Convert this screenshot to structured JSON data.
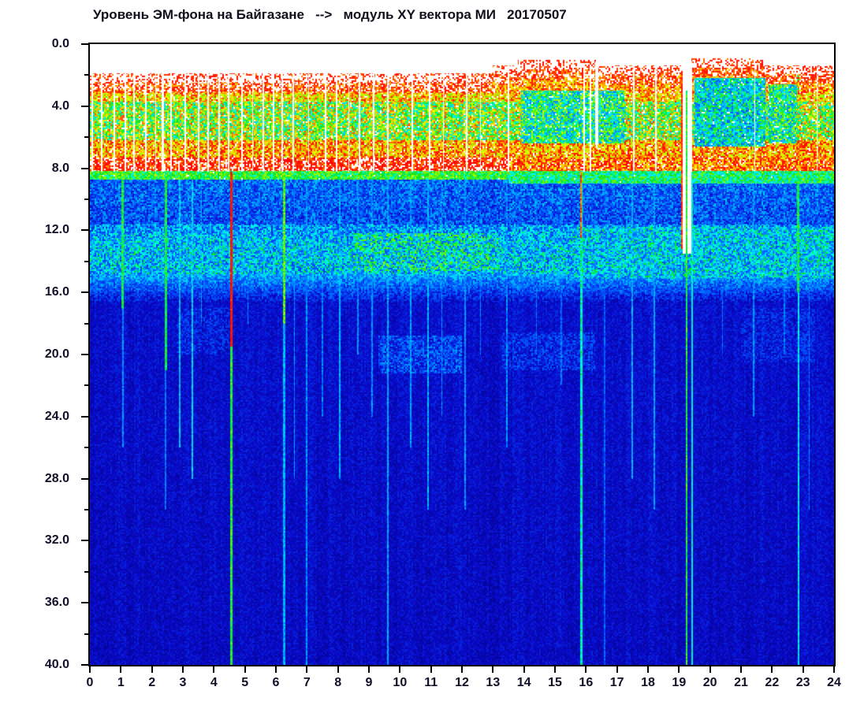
{
  "page": {
    "background": "#ffffff"
  },
  "chart_data": {
    "type": "heatmap",
    "subtype": "spectrogram",
    "title": "Уровень ЭМ-фона на Байгазане   -->   модуль XY вектора МИ   20170507",
    "x_axis": {
      "label": "",
      "min": 0,
      "max": 24,
      "unit": "hours",
      "tick_labels": [
        "0",
        "1",
        "2",
        "3",
        "4",
        "5",
        "6",
        "7",
        "8",
        "9",
        "10",
        "11",
        "12",
        "13",
        "14",
        "15",
        "16",
        "17",
        "18",
        "19",
        "20",
        "21",
        "22",
        "23",
        "24"
      ]
    },
    "y_axis": {
      "label": "",
      "min": 0,
      "max": 40,
      "unit": "Hz",
      "direction": "down",
      "tick_labels": [
        "0.0",
        "4.0",
        "8.0",
        "12.0",
        "16.0",
        "20.0",
        "24.0",
        "28.0",
        "32.0",
        "36.0",
        "40.0"
      ],
      "major_tick_step": 4,
      "minor_tick_step": 2
    },
    "colors": {
      "axis_text": "#101028",
      "axis_line": "#000000",
      "plot_background": "#ffffff",
      "deep_blue": "#0f0fc4",
      "cyan": "#00c8ff",
      "green": "#00dc28",
      "yellow": "#ebff00",
      "red": "#ff1e00",
      "white_saturated": "#ffffff"
    },
    "palette": {
      "white_above": 1.04,
      "stops": [
        [
          0.0,
          0,
          0,
          110
        ],
        [
          0.15,
          10,
          10,
          205
        ],
        [
          0.3,
          0,
          90,
          255
        ],
        [
          0.42,
          0,
          195,
          255
        ],
        [
          0.5,
          0,
          255,
          230
        ],
        [
          0.58,
          0,
          225,
          45
        ],
        [
          0.66,
          120,
          250,
          0
        ],
        [
          0.74,
          235,
          255,
          0
        ],
        [
          0.82,
          255,
          170,
          0
        ],
        [
          0.9,
          255,
          30,
          0
        ],
        [
          1.0,
          255,
          0,
          0
        ]
      ]
    },
    "top_zone": {
      "white_start_left": 1.9,
      "white_start_right": 1.35,
      "right_from_hour": 13,
      "dips": [
        {
          "t0": 13.8,
          "t1": 16.4,
          "f": 1.0
        },
        {
          "t0": 19.4,
          "t1": 21.7,
          "f": 0.9
        }
      ]
    },
    "fringe": [
      {
        "rel_end": 0.6,
        "v": 0.9,
        "n": 0.05,
        "wp": 0.62
      },
      {
        "rel_end": 1.2,
        "v": 0.88,
        "n": 0.08,
        "wp": 0.34
      },
      {
        "abs_end": 3.2,
        "v": 0.83,
        "n": 0.11,
        "wp": 0.12
      }
    ],
    "bands": [
      {
        "f0": 3.2,
        "f1": 3.7,
        "v": 0.78,
        "n": 0.14,
        "wp": 0.07
      },
      {
        "f0": 3.7,
        "f1": 6.2,
        "v": 0.66,
        "n": 0.22,
        "wp": 0.05
      },
      {
        "f0": 6.2,
        "f1": 7.3,
        "v": 0.82,
        "n": 0.14,
        "wp": 0.06
      },
      {
        "f0": 7.3,
        "f1": 8.15,
        "v": 0.92,
        "n": 0.1,
        "wp": 0.3
      },
      {
        "f0": 8.15,
        "f1": 8.75,
        "v": 0.6,
        "n": 0.1,
        "wp": 0.01
      },
      {
        "f0": 8.75,
        "f1": 11.6,
        "v": 0.31,
        "v2": 0.27,
        "n": 0.13,
        "wp": 0
      },
      {
        "f0": 11.6,
        "f1": 13.0,
        "v": 0.36,
        "v2": 0.42,
        "n": 0.16,
        "wp": 0
      },
      {
        "f0": 13.0,
        "f1": 14.8,
        "v": 0.42,
        "n": 0.17,
        "wp": 0
      },
      {
        "f0": 14.8,
        "f1": 16.6,
        "v": 0.4,
        "v2": 0.17,
        "n": 0.1,
        "wp": 0
      },
      {
        "f0": 16.6,
        "f1": 40.01,
        "v": 0.155,
        "v2": 0.132,
        "n": 0.055,
        "wp": 0
      }
    ],
    "regions": [
      {
        "t0": 13.5,
        "t1": 24.01,
        "f0": 7.3,
        "f1": 8.15,
        "v": 0.86,
        "n": 0.14,
        "wp": 0.1
      },
      {
        "t0": 13.9,
        "t1": 17.25,
        "f0": 3.0,
        "f1": 6.4,
        "v": 0.53,
        "n": 0.2,
        "wp": 0.04
      },
      {
        "t0": 19.5,
        "t1": 21.8,
        "f0": 2.2,
        "f1": 6.6,
        "v": 0.47,
        "n": 0.18,
        "wp": 0.04
      },
      {
        "t0": 21.9,
        "t1": 22.8,
        "f0": 2.6,
        "f1": 6.4,
        "v": 0.53,
        "n": 0.2,
        "wp": 0.04
      },
      {
        "t0": 13.5,
        "t1": 24.01,
        "f0": 8.15,
        "f1": 9.0,
        "v": 0.55,
        "n": 0.12,
        "wp": 0.01
      },
      {
        "t0": 8.5,
        "t1": 13.2,
        "f0": 12.2,
        "f1": 14.6,
        "v": 0.47,
        "n": 0.2,
        "wp": 0
      },
      {
        "t0": 15.5,
        "t1": 24.01,
        "f0": 11.8,
        "f1": 15.1,
        "v": 0.43,
        "n": 0.16,
        "wp": 0
      },
      {
        "t0": 9.3,
        "t1": 12.0,
        "f0": 18.8,
        "f1": 21.2,
        "v": 0.25,
        "n": 0.13,
        "wp": 0
      },
      {
        "t0": 13.3,
        "t1": 16.3,
        "f0": 18.6,
        "f1": 21.0,
        "v": 0.21,
        "n": 0.11,
        "wp": 0
      },
      {
        "t0": 2.8,
        "t1": 4.5,
        "f0": 17.0,
        "f1": 20.0,
        "v": 0.19,
        "n": 0.1,
        "wp": 0
      },
      {
        "t0": 21.0,
        "t1": 23.4,
        "f0": 17.0,
        "f1": 20.5,
        "v": 0.19,
        "n": 0.09,
        "wp": 0
      }
    ],
    "vertical_lines": [
      {
        "t": 1.06,
        "w": 0.07,
        "f0": 8.2,
        "f1": 17,
        "v": 0.58
      },
      {
        "t": 1.06,
        "w": 0.05,
        "f0": 17,
        "f1": 26,
        "v": 0.36
      },
      {
        "t": 2.45,
        "w": 0.07,
        "f0": 8.2,
        "f1": 21,
        "v": 0.58
      },
      {
        "t": 2.45,
        "w": 0.05,
        "f0": 21,
        "f1": 30,
        "v": 0.33
      },
      {
        "t": 2.9,
        "w": 0.05,
        "f0": 8.2,
        "f1": 26,
        "v": 0.42
      },
      {
        "t": 3.3,
        "w": 0.06,
        "f0": 8.2,
        "f1": 28,
        "v": 0.44
      },
      {
        "t": 3.6,
        "w": 0.04,
        "f0": 8.2,
        "f1": 18,
        "v": 0.38
      },
      {
        "t": 4.57,
        "w": 0.07,
        "f0": 8.2,
        "f1": 19.5,
        "v": 0.93
      },
      {
        "t": 4.57,
        "w": 0.07,
        "f0": 19.5,
        "f1": 40,
        "v": 0.6
      },
      {
        "t": 5.1,
        "w": 0.04,
        "f0": 8.7,
        "f1": 18,
        "v": 0.34
      },
      {
        "t": 6.27,
        "w": 0.08,
        "f0": 8.2,
        "f1": 18,
        "v": 0.64
      },
      {
        "t": 6.27,
        "w": 0.06,
        "f0": 18,
        "f1": 40,
        "v": 0.4
      },
      {
        "t": 6.6,
        "w": 0.04,
        "f0": 8.7,
        "f1": 28,
        "v": 0.36
      },
      {
        "t": 7.0,
        "w": 0.05,
        "f0": 8.7,
        "f1": 40,
        "v": 0.36
      },
      {
        "t": 7.5,
        "w": 0.04,
        "f0": 8.7,
        "f1": 24,
        "v": 0.34
      },
      {
        "t": 8.05,
        "w": 0.05,
        "f0": 8.7,
        "f1": 28,
        "v": 0.4
      },
      {
        "t": 8.65,
        "w": 0.04,
        "f0": 8.7,
        "f1": 20,
        "v": 0.36
      },
      {
        "t": 9.1,
        "w": 0.04,
        "f0": 8.7,
        "f1": 24,
        "v": 0.36
      },
      {
        "t": 9.62,
        "w": 0.05,
        "f0": 8.7,
        "f1": 40,
        "v": 0.38
      },
      {
        "t": 10.35,
        "w": 0.05,
        "f0": 8.7,
        "f1": 26,
        "v": 0.38
      },
      {
        "t": 10.9,
        "w": 0.05,
        "f0": 8.7,
        "f1": 30,
        "v": 0.4
      },
      {
        "t": 11.35,
        "w": 0.04,
        "f0": 8.7,
        "f1": 24,
        "v": 0.36
      },
      {
        "t": 12.1,
        "w": 0.05,
        "f0": 8.7,
        "f1": 30,
        "v": 0.36
      },
      {
        "t": 12.6,
        "w": 0.04,
        "f0": 8.7,
        "f1": 20,
        "v": 0.33
      },
      {
        "t": 13.45,
        "w": 0.05,
        "f0": 8.7,
        "f1": 26,
        "v": 0.36
      },
      {
        "t": 14.4,
        "w": 0.04,
        "f0": 8.7,
        "f1": 20,
        "v": 0.33
      },
      {
        "t": 15.2,
        "w": 0.04,
        "f0": 8.7,
        "f1": 22,
        "v": 0.32
      },
      {
        "t": 15.85,
        "w": 0.08,
        "f0": 8.2,
        "f1": 40,
        "v": 0.52
      },
      {
        "t": 15.85,
        "w": 0.05,
        "f0": 8.2,
        "f1": 12.5,
        "v": 0.88
      },
      {
        "t": 16.6,
        "w": 0.05,
        "f0": 8.7,
        "f1": 40,
        "v": 0.3
      },
      {
        "t": 17.5,
        "w": 0.05,
        "f0": 8.2,
        "f1": 28,
        "v": 0.4
      },
      {
        "t": 18.2,
        "w": 0.05,
        "f0": 8.2,
        "f1": 30,
        "v": 0.38
      },
      {
        "t": 19.1,
        "w": 0.05,
        "f0": 1.8,
        "f1": 13.2,
        "v": 0.9
      },
      {
        "t": 19.25,
        "w": 0.06,
        "f0": 3.0,
        "f1": 40,
        "v": 0.6
      },
      {
        "t": 19.42,
        "w": 0.05,
        "f0": 8.2,
        "f1": 40,
        "v": 0.5
      },
      {
        "t": 20.4,
        "w": 0.04,
        "f0": 8.7,
        "f1": 20,
        "v": 0.32
      },
      {
        "t": 21.4,
        "w": 0.04,
        "f0": 8.7,
        "f1": 24,
        "v": 0.36
      },
      {
        "t": 22.4,
        "w": 0.04,
        "f0": 8.7,
        "f1": 20,
        "v": 0.33
      },
      {
        "t": 22.85,
        "w": 0.07,
        "f0": 2.0,
        "f1": 16,
        "v": 0.58
      },
      {
        "t": 22.85,
        "w": 0.06,
        "f0": 16,
        "f1": 40,
        "v": 0.46
      },
      {
        "t": 23.2,
        "w": 0.04,
        "f0": 8.7,
        "f1": 30,
        "v": 0.33
      }
    ],
    "white_gaps": [
      {
        "t": 0.07,
        "w": 0.06
      },
      {
        "t": 0.38,
        "w": 0.06
      },
      {
        "t": 0.78,
        "w": 0.05
      },
      {
        "t": 1.15,
        "w": 0.04
      },
      {
        "t": 1.42,
        "w": 0.05
      },
      {
        "t": 1.8,
        "w": 0.05
      },
      {
        "t": 2.12,
        "w": 0.04
      },
      {
        "t": 2.35,
        "w": 0.06
      },
      {
        "t": 2.62,
        "w": 0.04
      },
      {
        "t": 3.08,
        "w": 0.05
      },
      {
        "t": 3.5,
        "w": 0.05
      },
      {
        "t": 3.82,
        "w": 0.04
      },
      {
        "t": 4.18,
        "w": 0.05
      },
      {
        "t": 4.48,
        "w": 0.04
      },
      {
        "t": 4.9,
        "w": 0.05
      },
      {
        "t": 5.25,
        "w": 0.05
      },
      {
        "t": 5.6,
        "w": 0.04
      },
      {
        "t": 5.92,
        "w": 0.05
      },
      {
        "t": 6.2,
        "w": 0.04
      },
      {
        "t": 6.55,
        "w": 0.05
      },
      {
        "t": 7.05,
        "w": 0.03
      },
      {
        "t": 7.6,
        "w": 0.04
      },
      {
        "t": 7.95,
        "w": 0.05
      },
      {
        "t": 8.35,
        "w": 0.04
      },
      {
        "t": 8.7,
        "w": 0.05
      },
      {
        "t": 9.15,
        "w": 0.04
      },
      {
        "t": 9.6,
        "w": 0.05
      },
      {
        "t": 10.4,
        "w": 0.05
      },
      {
        "t": 10.95,
        "w": 0.05
      },
      {
        "t": 11.4,
        "w": 0.04
      },
      {
        "t": 12.15,
        "w": 0.05
      },
      {
        "t": 12.6,
        "w": 0.03
      },
      {
        "t": 13.5,
        "w": 0.05
      },
      {
        "t": 15.95,
        "w": 0.05
      },
      {
        "t": 16.15,
        "w": 0.04
      },
      {
        "t": 16.35,
        "w": 0.09,
        "f0": 1.1,
        "f1": 6.5
      },
      {
        "t": 17.55,
        "w": 0.05
      },
      {
        "t": 18.25,
        "w": 0.05
      },
      {
        "t": 19.28,
        "w": 0.3,
        "f0": 1.1,
        "f1": 13.5
      },
      {
        "t": 21.45,
        "w": 0.04
      },
      {
        "t": 23.45,
        "w": 0.04
      }
    ],
    "white_gap_default_f0": 1.3,
    "white_gap_default_f1": 8.2
  }
}
